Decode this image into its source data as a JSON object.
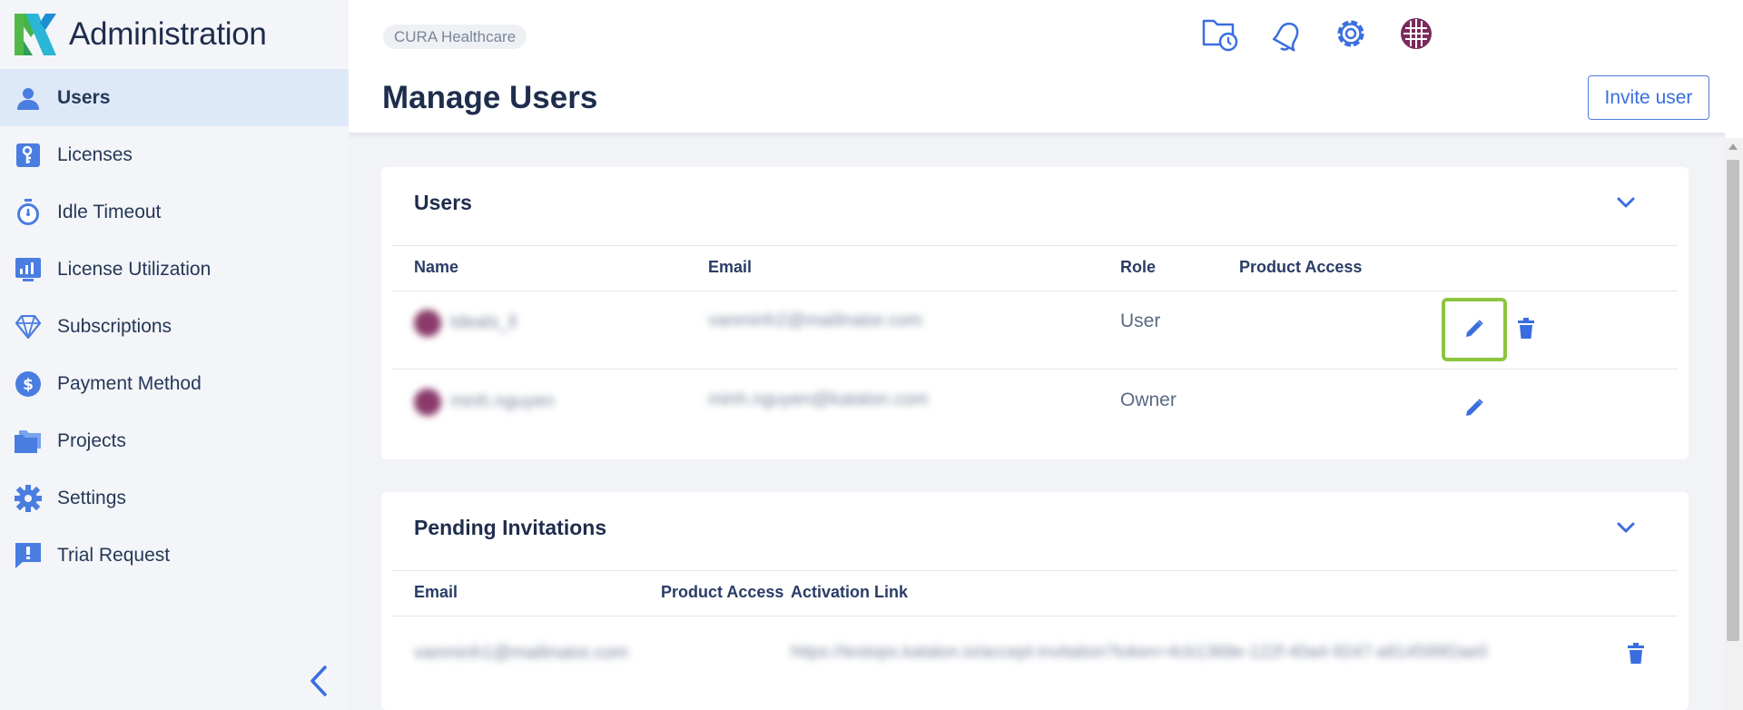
{
  "app": {
    "title": "Administration",
    "org": "CURA Healthcare"
  },
  "sidebar": {
    "items": [
      {
        "label": "Users",
        "icon": "user-icon",
        "active": true
      },
      {
        "label": "Licenses",
        "icon": "license-key-icon"
      },
      {
        "label": "Idle Timeout",
        "icon": "stopwatch-icon"
      },
      {
        "label": "License Utilization",
        "icon": "chart-monitor-icon"
      },
      {
        "label": "Subscriptions",
        "icon": "diamond-icon"
      },
      {
        "label": "Payment Method",
        "icon": "dollar-coin-icon"
      },
      {
        "label": "Projects",
        "icon": "folders-icon"
      },
      {
        "label": "Settings",
        "icon": "gear-icon"
      },
      {
        "label": "Trial Request",
        "icon": "alert-message-icon"
      }
    ]
  },
  "topbar": {
    "icons": [
      "folder-clock-icon",
      "bell-icon",
      "settings-gear-icon",
      "avatar-icon"
    ]
  },
  "page": {
    "title": "Manage Users",
    "invite_label": "Invite user"
  },
  "users": {
    "title": "Users",
    "columns": {
      "name": "Name",
      "email": "Email",
      "role": "Role",
      "product_access": "Product Access"
    },
    "rows": [
      {
        "name": "tdeals_ll",
        "email": "vanminh2@mailinator.com",
        "role": "User",
        "product_access": ""
      },
      {
        "name": "minh.nguyen",
        "email": "minh.nguyen@katalon.com",
        "role": "Owner",
        "product_access": ""
      }
    ]
  },
  "pending": {
    "title": "Pending Invitations",
    "columns": {
      "email": "Email",
      "product_access": "Product Access",
      "activation_link": "Activation Link"
    },
    "rows": [
      {
        "email": "vanminh1@mailinator.com",
        "product_access": "",
        "activation_link": "https://testops.katalon.io/accept-invitation?token=4cb1368e-122f-40a4-9247-a814599f2ae0"
      }
    ]
  },
  "colors": {
    "accent": "#3a6ee0",
    "highlight": "#8cc63f",
    "sidebar_active": "#dde9f8"
  }
}
